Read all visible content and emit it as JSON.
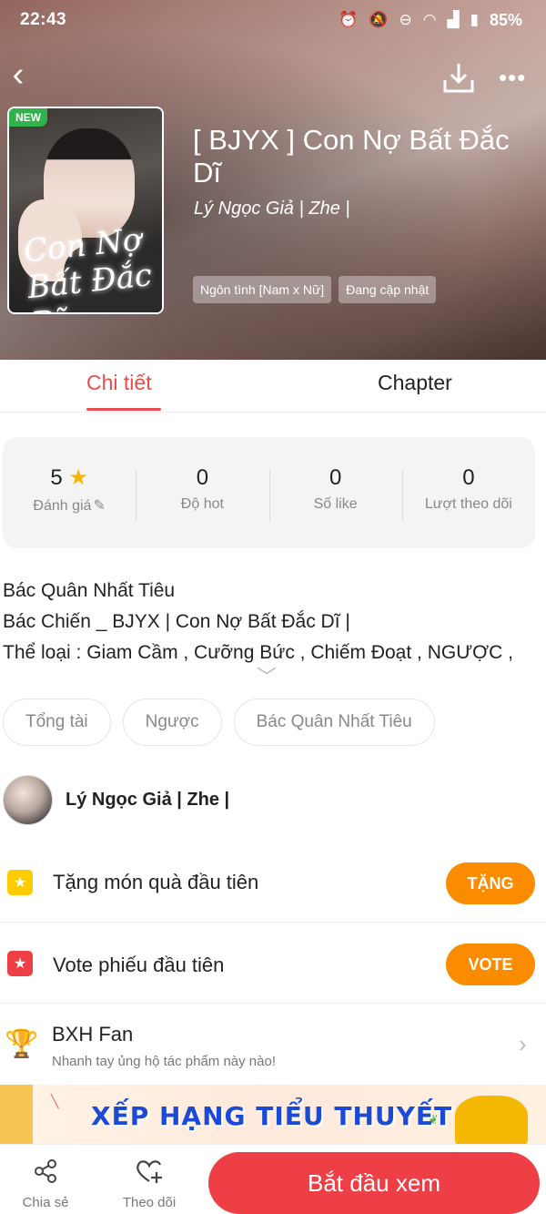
{
  "status_bar": {
    "time": "22:43",
    "battery": "85%",
    "icons": [
      "alarm-icon",
      "mute-icon",
      "dnd-icon",
      "wifi-icon",
      "signal-icon",
      "battery-icon"
    ]
  },
  "nav": {
    "back_icon": "chevron-left-icon",
    "download_icon": "download-icon",
    "more_icon": "more-dots-icon"
  },
  "book": {
    "badge": "NEW",
    "cover_title": "Con Nợ Bất Đắc Dĩ",
    "title_line1": "[ BJYX ] Con Nợ Bất Đắc",
    "title_line2": "Dĩ",
    "author": "Lý Ngọc Giả | Zhe |",
    "tags": [
      "Ngôn tình [Nam x Nữ]",
      "Đang cập nhật"
    ]
  },
  "tabs": [
    {
      "label": "Chi tiết",
      "active": true
    },
    {
      "label": "Chapter",
      "active": false
    }
  ],
  "stats": [
    {
      "value": "5",
      "label": "Đánh giá"
    },
    {
      "value": "0",
      "label": "Độ hot"
    },
    {
      "value": "0",
      "label": "Số like"
    },
    {
      "value": "0",
      "label": "Lượt theo dõi"
    }
  ],
  "description": [
    "Bác Quân Nhất Tiêu",
    "Bác Chiến _ BJYX | Con Nợ Bất Đắc Dĩ |",
    "Thể loại : Giam Cầm , Cưỡng Bức , Chiếm Đoạt , NGƯỢC ,"
  ],
  "genres": [
    "Tổng tài",
    "Ngược",
    "Bác Quân Nhất Tiêu"
  ],
  "author_row": {
    "name": "Lý Ngọc Giả | Zhe |"
  },
  "gift": {
    "label": "Tặng món quà đầu tiên",
    "button": "TẶNG"
  },
  "vote": {
    "label": "Vote phiếu đầu tiên",
    "button": "VOTE"
  },
  "fan": {
    "title": "BXH Fan",
    "subtitle": "Nhanh tay ủng hộ tác phẩm này nào!"
  },
  "banner": {
    "text": "XẾP HẠNG TIỂU THUYẾT"
  },
  "bottom_bar": {
    "share": "Chia sẻ",
    "follow": "Theo dõi",
    "start": "Bắt đầu xem"
  },
  "colors": {
    "accent": "#e84c4c",
    "button_orange": "#fb8c00",
    "start_red": "#ef3f46",
    "star": "#f7b500"
  }
}
